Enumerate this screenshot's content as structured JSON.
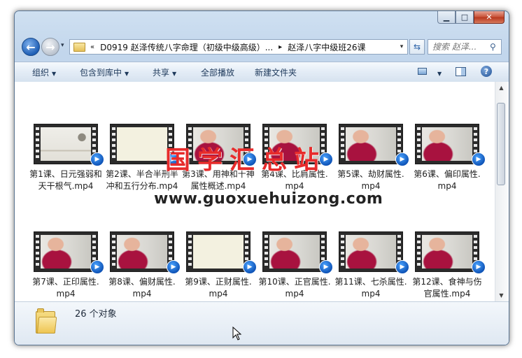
{
  "window": {
    "caption": {
      "minimize": "▁",
      "maximize": "□",
      "close": "✕"
    }
  },
  "address": {
    "history_glyph": "▾",
    "prefix": "«",
    "segments": [
      "D0919 赵泽传统八字命理（初级中级高级）...",
      "赵泽八字中级班26课"
    ],
    "separator": "▸",
    "dropdown": "▾",
    "refresh_glyph": "⇆"
  },
  "search": {
    "placeholder": "搜索 赵泽..."
  },
  "toolbar": {
    "organize": "组织",
    "include_in_library": "包含到库中",
    "share": "共享",
    "play_all": "全部播放",
    "new_folder": "新建文件夹",
    "help": "?"
  },
  "files": [
    {
      "name": "第1课、日元强弱和天干根气.mp4",
      "thumb": "screen"
    },
    {
      "name": "第2课、半合半刑半冲和五行分布.mp4",
      "thumb": "blank"
    },
    {
      "name": "第3课、用神和十神属性概述.mp4",
      "thumb": "person"
    },
    {
      "name": "第4课、比肩属性.mp4",
      "thumb": "person"
    },
    {
      "name": "第5课、劫财属性.mp4",
      "thumb": "person"
    },
    {
      "name": "第6课、偏印属性.mp4",
      "thumb": "person"
    },
    {
      "name": "第7课、正印属性.mp4",
      "thumb": "person"
    },
    {
      "name": "第8课、偏财属性.mp4",
      "thumb": "person"
    },
    {
      "name": "第9课、正财属性.mp4",
      "thumb": "blank"
    },
    {
      "name": "第10课、正官属性.mp4",
      "thumb": "person"
    },
    {
      "name": "第11课、七杀属性.mp4",
      "thumb": "person"
    },
    {
      "name": "第12课、食神与伤官属性.mp4",
      "thumb": "person"
    }
  ],
  "status": {
    "count": "26 个对象"
  },
  "watermark": {
    "title": "国学汇总站",
    "url": "www.guoxuehuizong.com"
  },
  "colors": {
    "accent": "#1f5fb6",
    "close": "#c9543a",
    "watermark": "#e72b2b"
  }
}
